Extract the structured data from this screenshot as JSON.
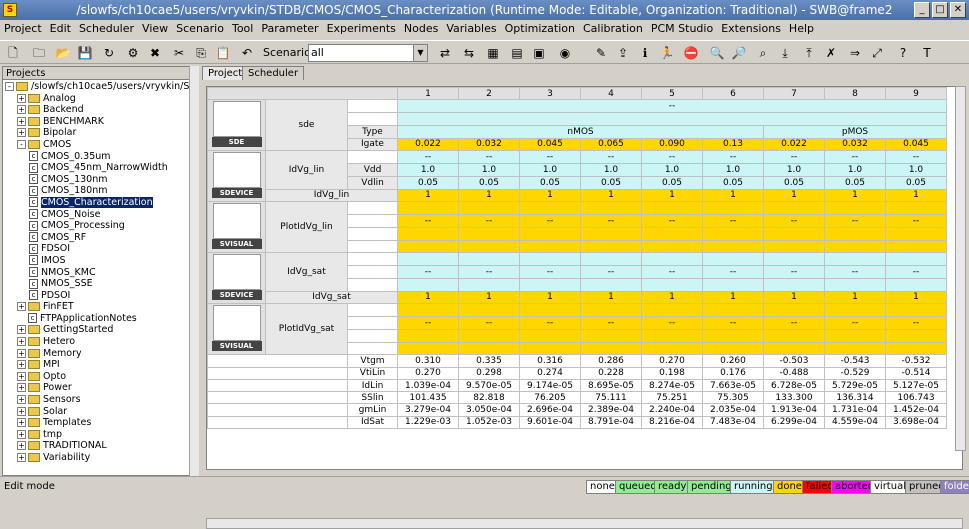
{
  "window": {
    "title": "/slowfs/ch10cae5/users/vryvkin/STDB/CMOS/CMOS_Characterization (Runtime Mode: Editable, Organization: Traditional) - SWB@frame2"
  },
  "menu": [
    "Project",
    "Edit",
    "Scheduler",
    "View",
    "Scenario",
    "Tool",
    "Parameter",
    "Experiments",
    "Nodes",
    "Variables",
    "Optimization",
    "Calibration",
    "PCM Studio",
    "Extensions",
    "Help"
  ],
  "toolbar": {
    "scenario_label": "Scenario:",
    "scenario_value": "all"
  },
  "left_panel": {
    "header": "Projects",
    "root": "/slowfs/ch10cae5/users/vryvkin/S",
    "items": [
      {
        "label": "Analog",
        "type": "folder",
        "level": 1,
        "exp": "+"
      },
      {
        "label": "Backend",
        "type": "folder",
        "level": 1,
        "exp": "+"
      },
      {
        "label": "BENCHMARK",
        "type": "folder",
        "level": 1,
        "exp": "+"
      },
      {
        "label": "Bipolar",
        "type": "folder",
        "level": 1,
        "exp": "+"
      },
      {
        "label": "CMOS",
        "type": "folder",
        "level": 1,
        "exp": "-"
      },
      {
        "label": "CMOS_0.35um",
        "type": "proj",
        "level": 2
      },
      {
        "label": "CMOS_45nm_NarrowWidth",
        "type": "proj",
        "level": 2
      },
      {
        "label": "CMOS_130nm",
        "type": "proj",
        "level": 2
      },
      {
        "label": "CMOS_180nm",
        "type": "proj",
        "level": 2
      },
      {
        "label": "CMOS_Characterization",
        "type": "proj",
        "level": 2,
        "selected": true
      },
      {
        "label": "CMOS_Noise",
        "type": "proj",
        "level": 2
      },
      {
        "label": "CMOS_Processing",
        "type": "proj",
        "level": 2
      },
      {
        "label": "CMOS_RF",
        "type": "proj",
        "level": 2
      },
      {
        "label": "FDSOI",
        "type": "proj",
        "level": 2
      },
      {
        "label": "IMOS",
        "type": "proj",
        "level": 2
      },
      {
        "label": "NMOS_KMC",
        "type": "proj",
        "level": 2
      },
      {
        "label": "NMOS_SSE",
        "type": "proj",
        "level": 2
      },
      {
        "label": "PDSOI",
        "type": "proj",
        "level": 2
      },
      {
        "label": "FinFET",
        "type": "folder",
        "level": 1,
        "exp": "+"
      },
      {
        "label": "FTPApplicationNotes",
        "type": "proj",
        "level": 1
      },
      {
        "label": "GettingStarted",
        "type": "folder",
        "level": 1,
        "exp": "+"
      },
      {
        "label": "Hetero",
        "type": "folder",
        "level": 1,
        "exp": "+"
      },
      {
        "label": "Memory",
        "type": "folder",
        "level": 1,
        "exp": "+"
      },
      {
        "label": "MPI",
        "type": "folder",
        "level": 1,
        "exp": "+"
      },
      {
        "label": "Opto",
        "type": "folder",
        "level": 1,
        "exp": "+"
      },
      {
        "label": "Power",
        "type": "folder",
        "level": 1,
        "exp": "+"
      },
      {
        "label": "Sensors",
        "type": "folder",
        "level": 1,
        "exp": "+"
      },
      {
        "label": "Solar",
        "type": "folder",
        "level": 1,
        "exp": "+"
      },
      {
        "label": "Templates",
        "type": "folder",
        "level": 1,
        "exp": "+"
      },
      {
        "label": "tmp",
        "type": "folder",
        "level": 1,
        "exp": "+"
      },
      {
        "label": "TRADITIONAL",
        "type": "folder",
        "level": 1,
        "exp": "+"
      },
      {
        "label": "Variability",
        "type": "folder",
        "level": 1,
        "exp": "+"
      }
    ]
  },
  "tabs": [
    "Project",
    "Scheduler"
  ],
  "grid": {
    "columns": [
      "1",
      "2",
      "3",
      "4",
      "5",
      "6",
      "7",
      "8",
      "9"
    ],
    "tools": {
      "sde": {
        "label": "SDE",
        "step": "sde"
      },
      "sdevice1": {
        "label": "SDEVICE",
        "step": "IdVg_lin"
      },
      "svisual1": {
        "label": "SVISUAL",
        "step": "PlotIdVg_lin"
      },
      "sdevice2": {
        "label": "SDEVICE",
        "step": "IdVg_sat"
      },
      "svisual2": {
        "label": "SVISUAL",
        "step": "PlotIdVg_sat"
      }
    },
    "sde_top": "--",
    "type_label": "Type",
    "type_nmos": "nMOS",
    "type_pmos": "pMOS",
    "igate_label": "Igate",
    "igate": [
      "0.022",
      "0.032",
      "0.045",
      "0.065",
      "0.090",
      "0.13",
      "0.022",
      "0.032",
      "0.045"
    ],
    "dash_row": [
      "--",
      "--",
      "--",
      "--",
      "--",
      "--",
      "--",
      "--",
      "--"
    ],
    "vdd_label": "Vdd",
    "vdd": [
      "1.0",
      "1.0",
      "1.0",
      "1.0",
      "1.0",
      "1.0",
      "1.0",
      "1.0",
      "1.0"
    ],
    "vdlin_label": "Vdlin",
    "vdlin": [
      "0.05",
      "0.05",
      "0.05",
      "0.05",
      "0.05",
      "0.05",
      "0.05",
      "0.05",
      "0.05"
    ],
    "idvglin_label": "IdVg_lin",
    "idvglin": [
      "1",
      "1",
      "1",
      "1",
      "1",
      "1",
      "1",
      "1",
      "1"
    ],
    "idvgsat_label": "IdVg_sat",
    "idvgsat": [
      "1",
      "1",
      "1",
      "1",
      "1",
      "1",
      "1",
      "1",
      "1"
    ],
    "results": [
      {
        "name": "Vtgm",
        "values": [
          "0.310",
          "0.335",
          "0.316",
          "0.286",
          "0.270",
          "0.260",
          "-0.503",
          "-0.543",
          "-0.532"
        ]
      },
      {
        "name": "VtiLin",
        "values": [
          "0.270",
          "0.298",
          "0.274",
          "0.228",
          "0.198",
          "0.176",
          "-0.488",
          "-0.529",
          "-0.514"
        ]
      },
      {
        "name": "IdLin",
        "values": [
          "1.039e-04",
          "9.570e-05",
          "9.174e-05",
          "8.695e-05",
          "8.274e-05",
          "7.663e-05",
          "6.728e-05",
          "5.729e-05",
          "5.127e-05"
        ]
      },
      {
        "name": "SSlin",
        "values": [
          "101.435",
          "82.818",
          "76.205",
          "75.111",
          "75.251",
          "75.305",
          "133.300",
          "136.314",
          "106.743"
        ]
      },
      {
        "name": "gmLin",
        "values": [
          "3.279e-04",
          "3.050e-04",
          "2.696e-04",
          "2.389e-04",
          "2.240e-04",
          "2.035e-04",
          "1.913e-04",
          "1.731e-04",
          "1.452e-04"
        ]
      },
      {
        "name": "IdSat",
        "values": [
          "1.229e-03",
          "1.052e-03",
          "9.601e-04",
          "8.791e-04",
          "8.216e-04",
          "7.483e-04",
          "6.299e-04",
          "4.559e-04",
          "3.698e-04"
        ]
      }
    ]
  },
  "status": {
    "mode": "Edit mode",
    "legend": [
      {
        "label": "none",
        "color": "#ffffff"
      },
      {
        "label": "queued",
        "color": "#90ee90"
      },
      {
        "label": "ready",
        "color": "#90ee90"
      },
      {
        "label": "pending",
        "color": "#90ee90"
      },
      {
        "label": "running",
        "color": "#ccf5f5"
      },
      {
        "label": "done",
        "color": "#ffd700"
      },
      {
        "label": "failed",
        "color": "#ff0000"
      },
      {
        "label": "aborted",
        "color": "#ff00ff"
      },
      {
        "label": "virtual",
        "color": "#ffffff"
      },
      {
        "label": "pruned",
        "color": "#c0c0c0"
      },
      {
        "label": "folded",
        "color": "#9080c0"
      }
    ]
  }
}
